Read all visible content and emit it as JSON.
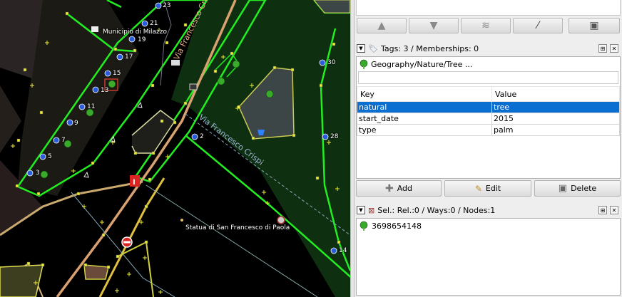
{
  "map": {
    "labels": {
      "municipio": "Municipio di Milazzo",
      "statua": "Statua di San Francesco di Paola",
      "street_main": "Via Francesco Crispi",
      "street_diag": "Via Francesco Crispi"
    },
    "house_numbers": [
      "23",
      "21",
      "19",
      "17",
      "15",
      "13",
      "11",
      "9",
      "7",
      "5",
      "3",
      "2",
      "30",
      "28",
      "14"
    ]
  },
  "toolbar": {
    "icons": [
      "arrow-up-icon",
      "arrow-down-icon",
      "merge-icon",
      "split-icon",
      "trash-icon"
    ]
  },
  "tags_panel": {
    "title": "Tags: 3 / Memberships: 0",
    "preset": "Geography/Nature/Tree ...",
    "headers": {
      "key": "Key",
      "value": "Value"
    },
    "rows": [
      {
        "key": "natural",
        "value": "tree"
      },
      {
        "key": "start_date",
        "value": "2015"
      },
      {
        "key": "type",
        "value": "palm"
      }
    ],
    "buttons": {
      "add": "Add",
      "edit": "Edit",
      "delete": "Delete"
    }
  },
  "selection_panel": {
    "title": "Sel.: Rel.:0 / Ways:0 / Nodes:1",
    "items": [
      "3698654148"
    ]
  },
  "colors": {
    "selection_blue": "#0a6fd1",
    "way_green": "#22ee22",
    "node_yellow": "#eeee33",
    "park_dark_green": "#0f3312"
  }
}
